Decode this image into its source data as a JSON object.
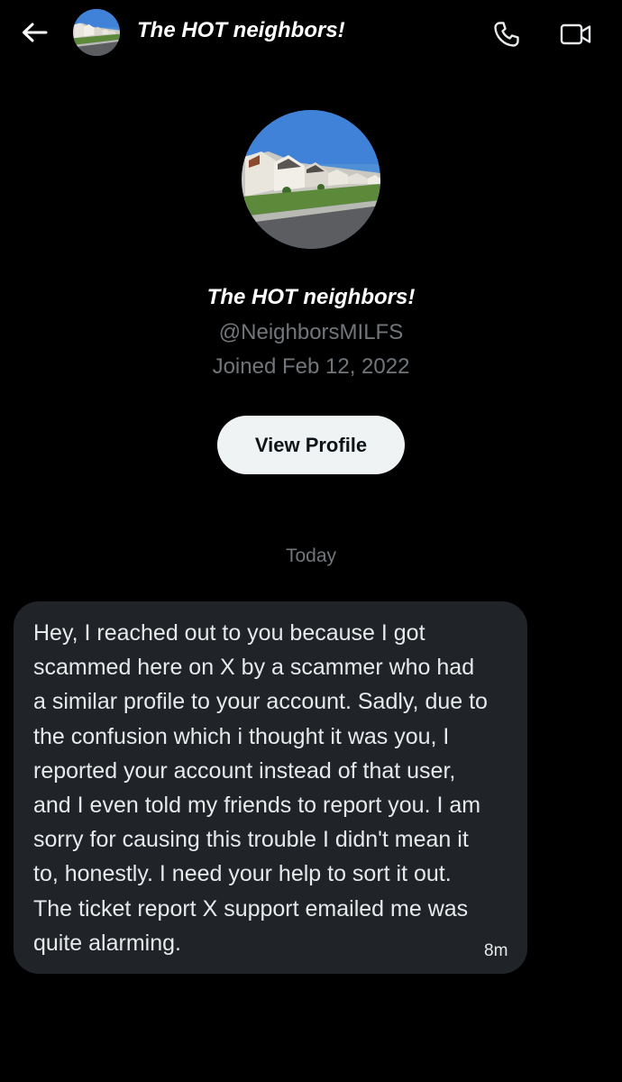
{
  "header": {
    "back_icon": "arrow-left-icon",
    "title": "The HOT neighbors!",
    "call_icon": "phone-icon",
    "video_icon": "video-camera-icon"
  },
  "profile": {
    "name": "The HOT neighbors!",
    "handle": "@NeighborsMILFS",
    "joined": "Joined Feb 12, 2022",
    "view_profile_label": "View Profile"
  },
  "conversation": {
    "date_divider": "Today",
    "messages": [
      {
        "text": "Hey, I reached out to you because I got scammed here on X by a scammer who had a similar profile to your account. Sadly, due to the confusion which i thought it was you, I reported your account instead of that user, and I even told my friends to report you. I am sorry for causing this trouble I didn't mean it to, honestly. I need your help to sort it out. The ticket report X support emailed me was quite alarming.",
        "time": "8m"
      }
    ]
  },
  "colors": {
    "background": "#000000",
    "bubble": "#202327",
    "secondary_text": "#71767b",
    "button_bg": "#eff3f4"
  }
}
